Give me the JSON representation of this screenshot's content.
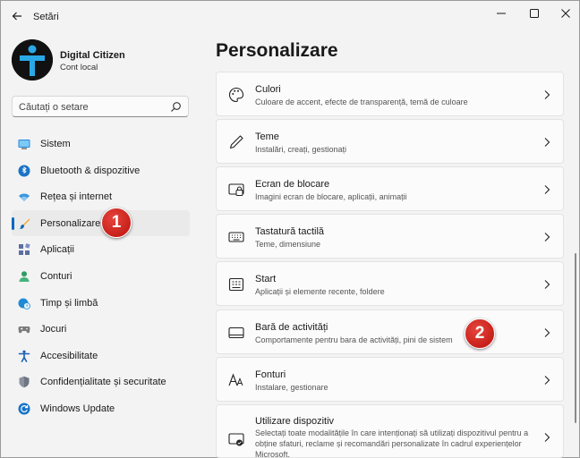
{
  "window": {
    "title": "Setări",
    "controls": {
      "back": "arrow-left-icon",
      "minimize": "minimize-icon",
      "maximize": "maximize-icon",
      "close": "close-icon"
    }
  },
  "user": {
    "name": "Digital Citizen",
    "account_type": "Cont local"
  },
  "search": {
    "placeholder": "Căutați o setare",
    "value": ""
  },
  "sidebar": {
    "items": [
      {
        "label": "Sistem",
        "icon": "monitor-icon",
        "active": false
      },
      {
        "label": "Bluetooth & dispozitive",
        "icon": "bluetooth-icon",
        "active": false
      },
      {
        "label": "Rețea și internet",
        "icon": "wifi-icon",
        "active": false
      },
      {
        "label": "Personalizare",
        "icon": "brush-icon",
        "active": true
      },
      {
        "label": "Aplicații",
        "icon": "apps-icon",
        "active": false
      },
      {
        "label": "Conturi",
        "icon": "account-icon",
        "active": false
      },
      {
        "label": "Timp și limbă",
        "icon": "globe-clock-icon",
        "active": false
      },
      {
        "label": "Jocuri",
        "icon": "gamepad-icon",
        "active": false
      },
      {
        "label": "Accesibilitate",
        "icon": "accessibility-icon",
        "active": false
      },
      {
        "label": "Confidențialitate și securitate",
        "icon": "shield-icon",
        "active": false
      },
      {
        "label": "Windows Update",
        "icon": "update-icon",
        "active": false
      }
    ]
  },
  "callouts": {
    "first": "1",
    "second": "2"
  },
  "main": {
    "title": "Personalizare",
    "cards": [
      {
        "title": "Culori",
        "subtitle": "Culoare de accent, efecte de transparență, temă de culoare",
        "icon": "palette-icon"
      },
      {
        "title": "Teme",
        "subtitle": "Instalări, creați, gestionați",
        "icon": "pen-icon"
      },
      {
        "title": "Ecran de blocare",
        "subtitle": "Imagini ecran de blocare, aplicații, animații",
        "icon": "lock-screen-icon"
      },
      {
        "title": "Tastatură tactilă",
        "subtitle": "Teme, dimensiune",
        "icon": "keyboard-icon"
      },
      {
        "title": "Start",
        "subtitle": "Aplicații și elemente recente, foldere",
        "icon": "start-menu-icon"
      },
      {
        "title": "Bară de activități",
        "subtitle": "Comportamente pentru bara de activități, pini de sistem",
        "icon": "taskbar-icon"
      },
      {
        "title": "Fonturi",
        "subtitle": "Instalare, gestionare",
        "icon": "font-icon"
      },
      {
        "title": "Utilizare dispozitiv",
        "subtitle": "Selectați toate modalitățile în care intenționați să utilizați dispozitivul pentru a obține sfaturi, reclame și recomandări personalizate în cadrul experiențelor Microsoft.",
        "icon": "device-usage-icon"
      }
    ]
  },
  "colors": {
    "accent": "#0067c0",
    "callout": "#d22b23",
    "background": "#f3f3f3",
    "card": "#fbfbfb"
  }
}
